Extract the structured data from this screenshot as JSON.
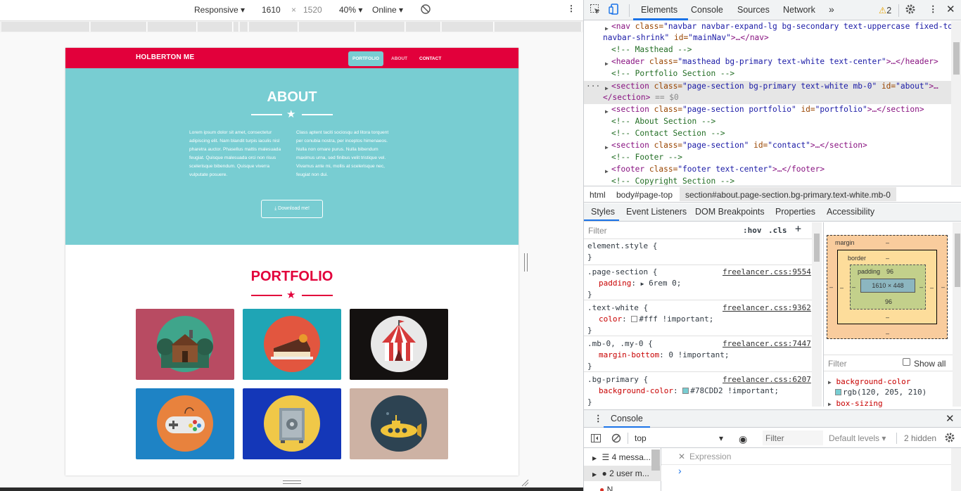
{
  "device_toolbar": {
    "mode": "Responsive",
    "width": "1610",
    "height": "1520",
    "zoom": "40%",
    "network": "Online"
  },
  "site": {
    "brand": "HOLBERTON ME",
    "nav": [
      "PORTFOLIO",
      "ABOUT",
      "CONTACT"
    ],
    "about_title": "ABOUT",
    "about_left": "Lorem ipsum dolor sit amet, consectetur adipiscing elit. Nam blandit turpis iaculis nisl pharetra auctor. Phasellus mattis malesuada feugiat. Quisque malesuada orci non risus scelerisque bibendum. Quisque viverra vulputate posuere.",
    "about_right": "Class aptent taciti sociosqu ad litora torquent per conubia nostra, per inceptos himenaeos. Nulla non ornare purus. Nulla bibendum maximus urna, sed finibus velit tristique vel. Vivamus ante mi, mollis at scelerisque nec, feugiat non dui.",
    "download_label": "Download me!",
    "portfolio_title": "PORTFOLIO",
    "cards": [
      {
        "name": "cabin",
        "bg": "#b84b62",
        "disc": "#3fa58b"
      },
      {
        "name": "cake",
        "bg": "#1fa5b5",
        "disc": "#e2563f"
      },
      {
        "name": "circus",
        "bg": "#141110",
        "disc": "#e8e8e8"
      },
      {
        "name": "game",
        "bg": "#1e83c5",
        "disc": "#e8823d"
      },
      {
        "name": "safe",
        "bg": "#1437b8",
        "disc": "#f0c848"
      },
      {
        "name": "submarine",
        "bg": "#cdb2a4",
        "disc": "#2d4352"
      }
    ]
  },
  "devtools": {
    "tabs": [
      "Elements",
      "Console",
      "Sources",
      "Network"
    ],
    "warnings": "2",
    "dom_lines": {
      "l1": {
        "tag": "<nav",
        "a1": " class=",
        "v1": "\"navbar navbar-expand-lg bg-secondary text-uppercase fixed-top",
        "v1b": "navbar-shrink\"",
        "a2": " id=",
        "v2": "\"mainNav\"",
        "end": ">…</nav>"
      },
      "l2": "<!-- Masthead -->",
      "l3": {
        "tag": "<header",
        "a1": " class=",
        "v1": "\"masthead bg-primary text-white text-center\"",
        "end": ">…</header>"
      },
      "l4": "<!-- Portfolio Section -->",
      "l5": {
        "tag": "<section",
        "a1": " class=",
        "v1": "\"page-section bg-primary text-white mb-0\"",
        "a2": " id=",
        "v2": "\"about\"",
        "end": ">…",
        "close": "</section>",
        "eq": " == $0"
      },
      "l6": {
        "tag": "<section",
        "a1": " class=",
        "v1": "\"page-section portfolio\"",
        "a2": " id=",
        "v2": "\"portfolio\"",
        "end": ">…</section>"
      },
      "l7": "<!-- About Section -->",
      "l8": "<!-- Contact Section -->",
      "l9": {
        "tag": "<section",
        "a1": " class=",
        "v1": "\"page-section\"",
        "a2": " id=",
        "v2": "\"contact\"",
        "end": ">…</section>"
      },
      "l10": "<!-- Footer -->",
      "l11": {
        "tag": "<footer",
        "a1": " class=",
        "v1": "\"footer text-center\"",
        "end": ">…</footer>"
      },
      "l12": "<!-- Copyright Section -->"
    },
    "breadcrumbs": [
      "html",
      "body#page-top",
      "section#about.page-section.bg-primary.text-white.mb-0"
    ],
    "subtabs": [
      "Styles",
      "Event Listeners",
      "DOM Breakpoints",
      "Properties",
      "Accessibility"
    ],
    "styles_filter": "Filter",
    "hov": ":hov",
    "cls": ".cls",
    "rules": [
      {
        "selector": "element.style {",
        "close": "}"
      },
      {
        "selector": ".page-section {",
        "src": "freelancer.css:9554",
        "prop": "padding",
        "value": "6rem 0;",
        "close": "}"
      },
      {
        "selector": ".text-white {",
        "src": "freelancer.css:9362",
        "prop": "color",
        "value": "#fff !important;",
        "close": "}"
      },
      {
        "selector": ".mb-0, .my-0 {",
        "src": "freelancer.css:7447",
        "prop": "margin-bottom",
        "value": "0 !important;",
        "close": "}"
      },
      {
        "selector": ".bg-primary {",
        "src": "freelancer.css:6207",
        "prop": "background-color",
        "value": "#78CDD2 !important;",
        "close": "}"
      }
    ],
    "boxmodel": {
      "margin": "margin",
      "border": "border",
      "padding": "padding",
      "padding_val": "96",
      "padding_bottom": "96",
      "content": "1610 × 448",
      "dash": "–"
    },
    "computed": {
      "filter": "Filter",
      "showall": "Show all",
      "p1": "background-color",
      "v1": "rgb(120, 205, 210)",
      "p2": "box-sizing"
    },
    "console_tab": "Console",
    "context": "top",
    "console_filter": "Filter",
    "levels": "Default levels",
    "hidden": "2 hidden",
    "messages": "4 messa...",
    "user_messages": "2 user m...",
    "next_item": "N...",
    "expression": "Expression",
    "chevron": "›",
    "colors": {
      "accent": "#1a73e8",
      "brand_red": "#e2003b",
      "primary_bg": "#78cdd2"
    }
  }
}
